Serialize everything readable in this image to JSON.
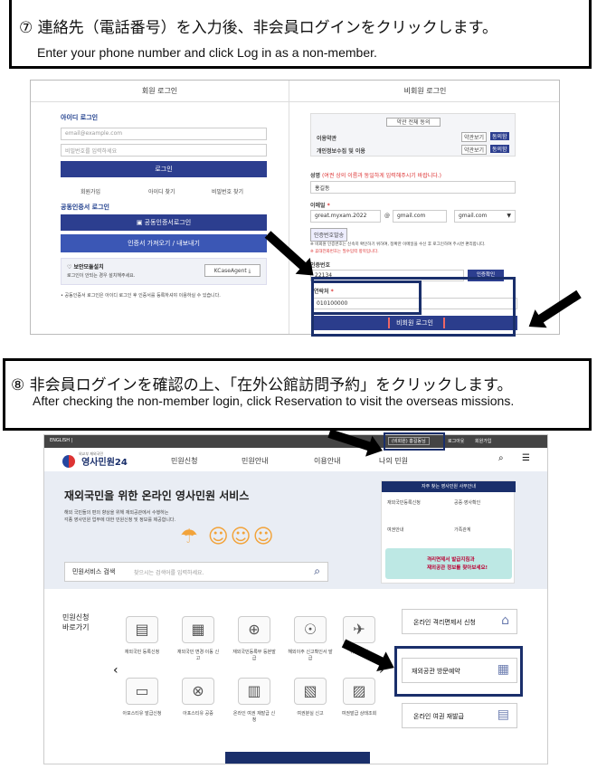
{
  "step7": {
    "jp": "⑦ 連絡先（電話番号）を入力後、非会員ログインをクリックします。",
    "en": "Enter your phone number and click Log in as a non-member."
  },
  "login_shot": {
    "member_tab": "회원 로그인",
    "nonmember_tab": "비회원 로그인",
    "id_login_title": "아이디 로그인",
    "email_placeholder": "email@example.com",
    "password_placeholder": "비밀번호를 입력하세요",
    "login_button": "로그인",
    "links": [
      "회원가입",
      "아이디 찾기",
      "비밀번호 찾기"
    ],
    "cert_title": "공동인증서 로그인",
    "cert_button": "공동인증서로그인",
    "cert_button2": "인증서 가져오기 / 내보내기",
    "security_title": "보안모듈설치",
    "security_desc": "로그인이 안되는 경우 설치해주세요.",
    "security_btn": "KCaseAgent",
    "cert_note": "• 공동인증서 로그인은 아이디 로그인 후 인증서를 등록하셔야 이용하실 수 있습니다.",
    "agree_all": "약관 전체 동의",
    "terms": [
      {
        "label": "이용약관",
        "view": "약관보기",
        "agree": "동의함"
      },
      {
        "label": "개인정보수집 및 이용",
        "view": "약관보기",
        "agree": "동의함"
      }
    ],
    "name_label": "성명",
    "name_hint": "(여권 상의 이름과 동일하게 입력해주시기 바랍니다.)",
    "name_value": "홍길동",
    "email_label": "이메일",
    "email_id": "great.myxam.2022",
    "email_at": "@",
    "email_domain": "gmail.com",
    "email_select": "gmail.com",
    "send_code_btn": "인증번호발송",
    "email_note1": "※ 비회원 인증번호는 신속히 확인하기 위하여, 정확한 이메일을 수신 후 로그인하여 주시면 편리합니다.",
    "email_note2": "※ 휴대전화번호는 필수입력 항목입니다.",
    "code_label": "인증번호",
    "code_value": "22134",
    "code_confirm_btn": "인증확인",
    "phone_label": "연락처",
    "phone_value": "010100000",
    "nonmember_login_btn": "비회원 로그인"
  },
  "step8": {
    "jp": "⑧ 非会員ログインを確認の上、「在外公館訪問予約」をクリックします。",
    "en": "After checking the non-member login, click Reservation to visit the overseas missions."
  },
  "portal_shot": {
    "lang": "ENGLISH |",
    "topbar_user": "(비회원) 홍길동님",
    "topbar_logout": "로그아웃",
    "topbar_mypage": "회원가입",
    "brand_small": "외교부 재외국민",
    "brand": "영사민원24",
    "nav": [
      "민원신청",
      "민원안내",
      "이용안내",
      "나의 민원"
    ],
    "hero_title": "재외국민을 위한 온라인 영사민원 서비스",
    "hero_sub1": "해외 국민들의 편의 향상을 위해 재외공관에서 수행하는",
    "hero_sub2": "각종 영사민원 업무에 대한 민원신청 및 정보를 제공합니다.",
    "search_label": "민원서비스 검색",
    "search_placeholder": "찾으시는 검색어를 입력하세요.",
    "faq_title": "자주 찾는 영사민원 사무안내",
    "faq_items": [
      "재외국민등록신청",
      "공증·영사확인",
      "여권안내",
      "가족관계"
    ],
    "banner_text1": "격리면제서 발급지침과",
    "banner_text2": "재외공관 정보를 찾아보세요!",
    "shortcut_title1": "민원신청",
    "shortcut_title2": "바로가기",
    "shortcuts_row1": [
      "재외국민 등록신청",
      "재외국민 변경·이동 신고",
      "재외국민등록부 등본발급",
      "해외이주 신고확인서 발급",
      "귀국 신청"
    ],
    "shortcuts_row2": [
      "아포스티유 발급신청",
      "아포스티유 공증",
      "온라인 여권 재발급 신청",
      "여권분실 신고",
      "여권발급 상태조회"
    ],
    "side_buttons": [
      "온라인 격리면제서 신청",
      "재외공관 방문예약",
      "온라인 여권 재발급"
    ]
  }
}
